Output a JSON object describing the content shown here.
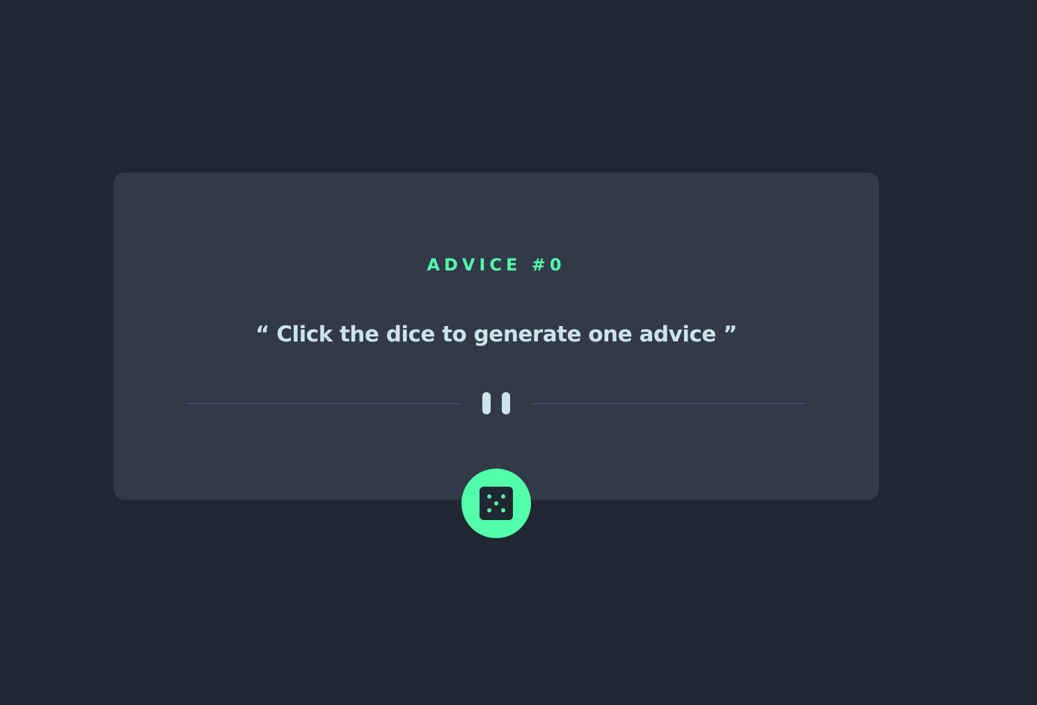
{
  "advice": {
    "id_label": "ADVICE #0",
    "quote": "“ Click the dice to generate one advice ”"
  },
  "colors": {
    "background": "#202632",
    "card": "#323a49",
    "accent": "#53ffab",
    "text": "#cee3e9",
    "divider": "#4f5d74"
  },
  "icons": {
    "divider_icon": "pause-icon",
    "button_icon": "dice-icon"
  }
}
